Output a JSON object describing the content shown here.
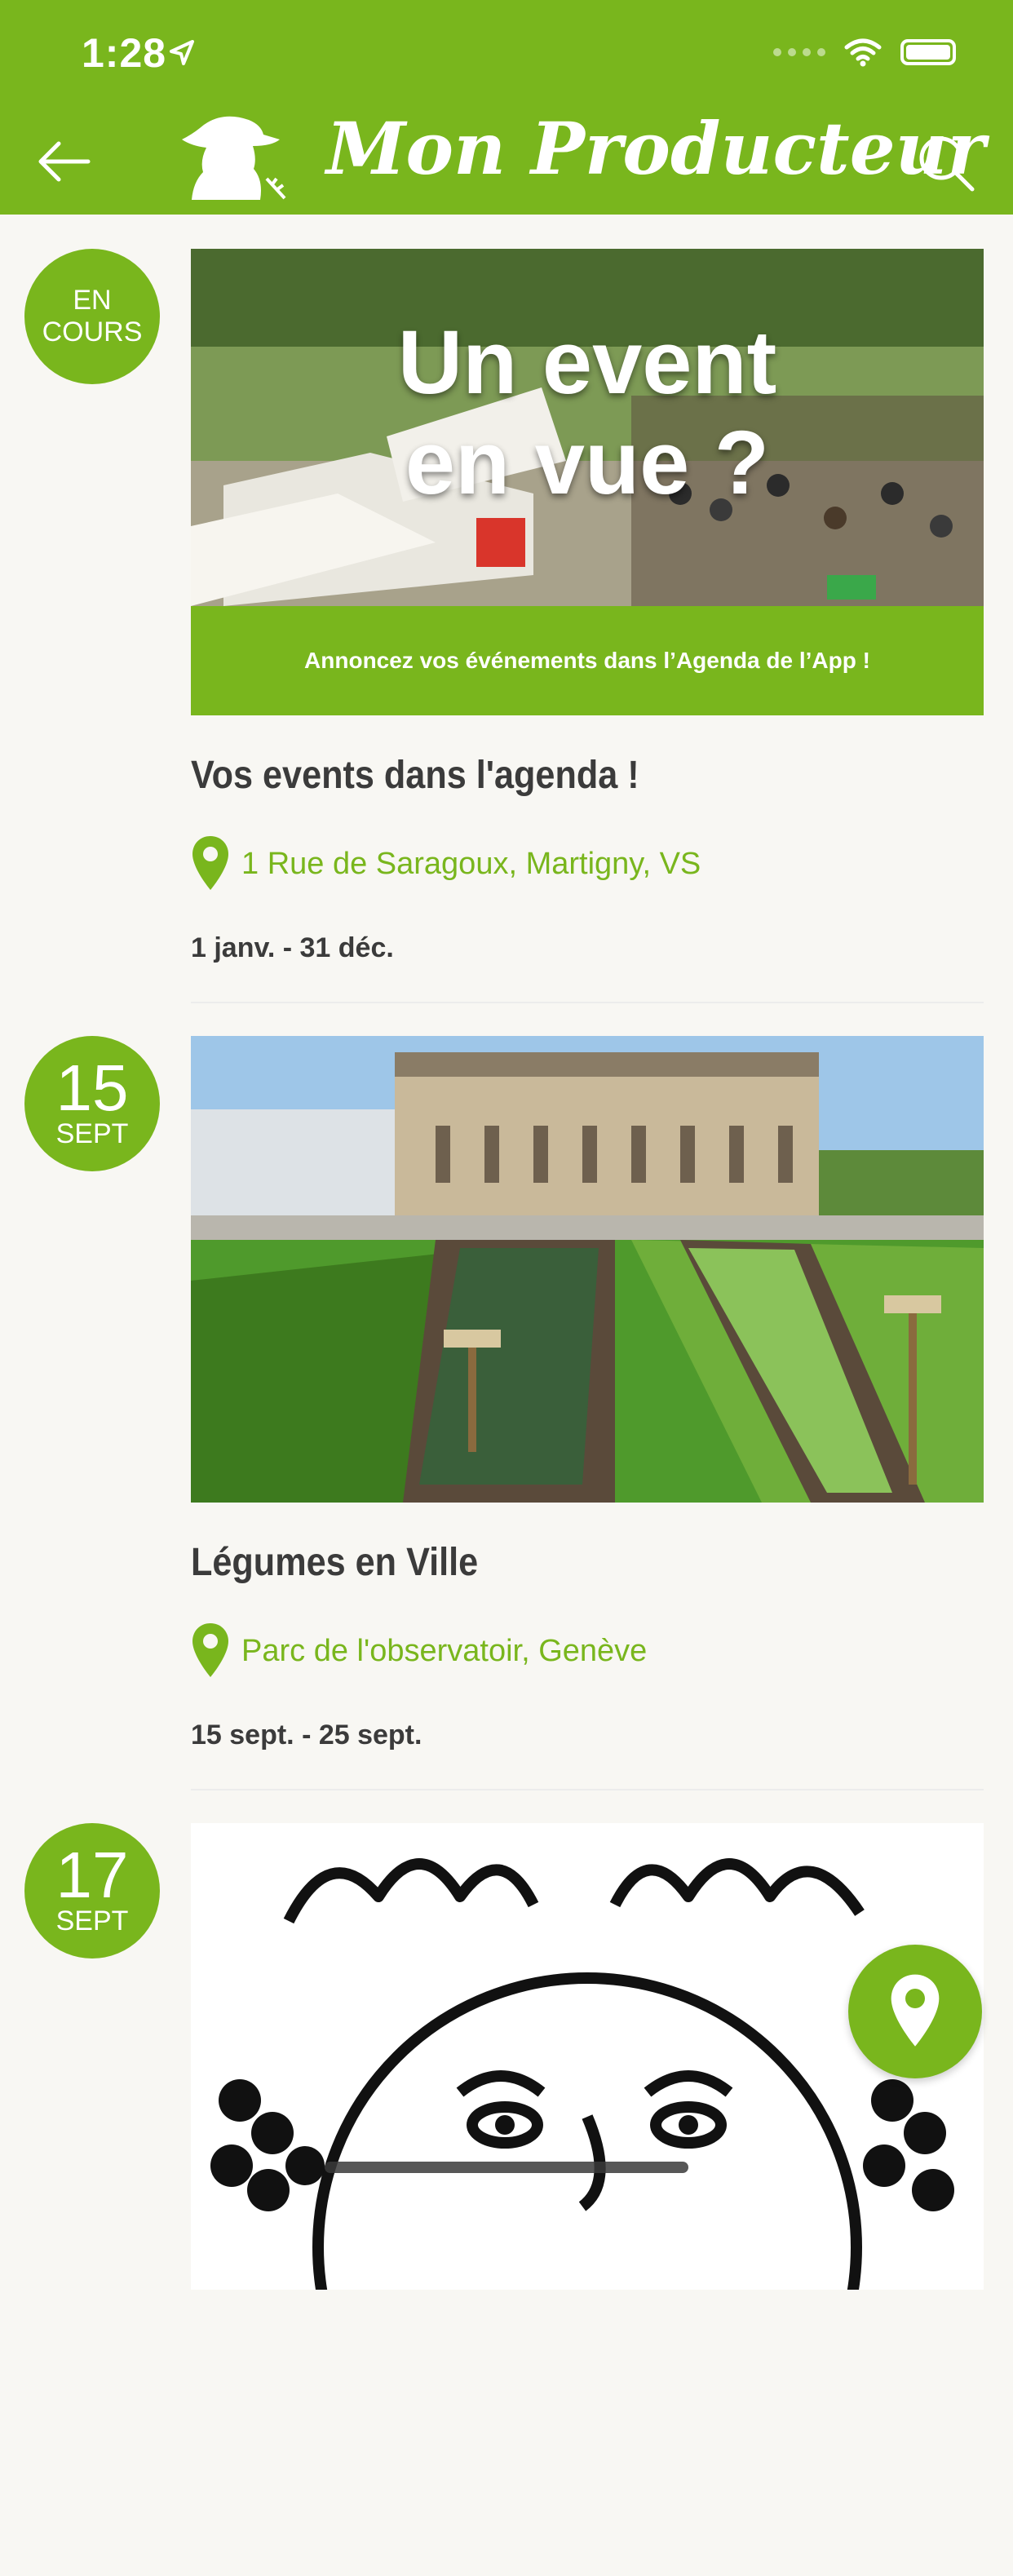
{
  "status_bar": {
    "time": "1:28"
  },
  "header": {
    "title": "Mon Producteur"
  },
  "events": [
    {
      "badge": {
        "line1": "EN",
        "line2": "COURS"
      },
      "image": {
        "headline1": "Un event",
        "headline2": "en vue ?",
        "banner": "Annoncez vos événements dans l’Agenda de l’App !"
      },
      "title": "Vos events dans l'agenda !",
      "location": "1 Rue de Saragoux, Martigny, VS",
      "dates": "1 janv. - 31 déc."
    },
    {
      "badge": {
        "day": "15",
        "month": "SEPT"
      },
      "title": "Légumes en Ville",
      "location": "Parc de l'observatoir, Genève",
      "dates": "15 sept. - 25 sept."
    },
    {
      "badge": {
        "day": "17",
        "month": "SEPT"
      }
    }
  ],
  "colors": {
    "brand": "#79b61d",
    "text": "#3b3b3b",
    "background": "#f8f7f3"
  }
}
